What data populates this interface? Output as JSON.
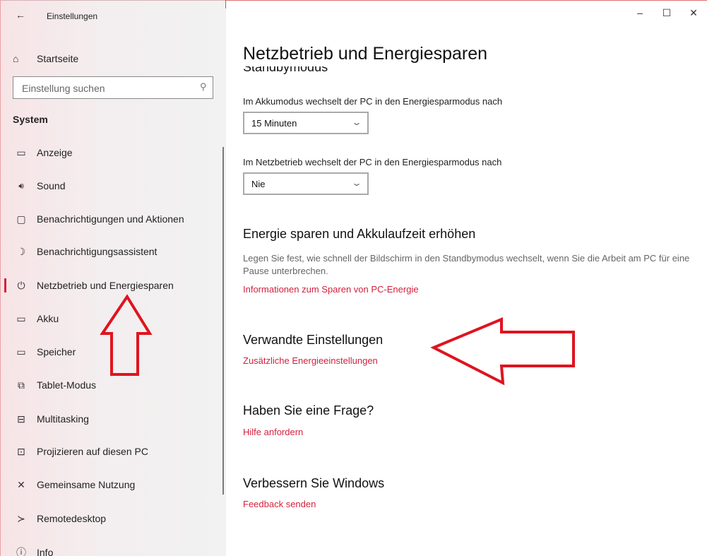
{
  "window": {
    "app_title": "Einstellungen",
    "back_icon": "back-arrow-icon",
    "controls": {
      "minimize": "–",
      "maximize": "☐",
      "close": "✕"
    }
  },
  "sidebar": {
    "home_label": "Startseite",
    "search_placeholder": "Einstellung suchen",
    "section": "System",
    "items": [
      {
        "label": "Anzeige",
        "icon": "display-icon",
        "glyph": "▭"
      },
      {
        "label": "Sound",
        "icon": "speaker-icon",
        "glyph": "🔊︎"
      },
      {
        "label": "Benachrichtigungen und Aktionen",
        "icon": "notification-icon",
        "glyph": "▢"
      },
      {
        "label": "Benachrichtigungsassistent",
        "icon": "moon-icon",
        "glyph": "☽"
      },
      {
        "label": "Netzbetrieb und Energiesparen",
        "icon": "power-icon",
        "glyph": "⏻",
        "active": true
      },
      {
        "label": "Akku",
        "icon": "battery-icon",
        "glyph": "▭"
      },
      {
        "label": "Speicher",
        "icon": "storage-icon",
        "glyph": "▭"
      },
      {
        "label": "Tablet-Modus",
        "icon": "tablet-mode-icon",
        "glyph": "⧉"
      },
      {
        "label": "Multitasking",
        "icon": "multitasking-icon",
        "glyph": "⊟"
      },
      {
        "label": "Projizieren auf diesen PC",
        "icon": "project-icon",
        "glyph": "⊡"
      },
      {
        "label": "Gemeinsame Nutzung",
        "icon": "share-icon",
        "glyph": "✕"
      },
      {
        "label": "Remotedesktop",
        "icon": "remote-desktop-icon",
        "glyph": "≻"
      },
      {
        "label": "Info",
        "icon": "info-icon",
        "glyph": "ⓘ"
      }
    ]
  },
  "main": {
    "title": "Netzbetrieb und Energiesparen",
    "cut_heading": "Standbymodus",
    "battery_label": "Im Akkumodus wechselt der PC in den Energiesparmodus nach",
    "battery_value": "15 Minuten",
    "ac_label": "Im Netzbetrieb wechselt der PC in den Energiesparmodus nach",
    "ac_value": "Nie",
    "save_heading": "Energie sparen und Akkulaufzeit erhöhen",
    "save_desc": "Legen Sie fest, wie schnell der Bildschirm in den Standbymodus wechselt, wenn Sie die Arbeit am PC für eine Pause unterbrechen.",
    "save_link": "Informationen zum Sparen von PC-Energie",
    "related_heading": "Verwandte Einstellungen",
    "related_link": "Zusätzliche Energieeinstellungen",
    "question_heading": "Haben Sie eine Frage?",
    "question_link": "Hilfe anfordern",
    "improve_heading": "Verbessern Sie Windows",
    "improve_link": "Feedback senden"
  },
  "colors": {
    "accent": "#d4213d",
    "annotation_arrow": "#e0131f"
  }
}
